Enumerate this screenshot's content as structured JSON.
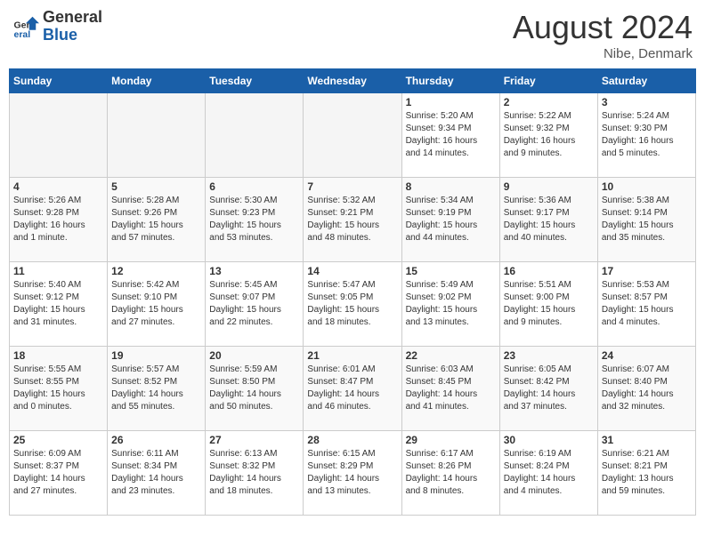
{
  "header": {
    "logo_general": "General",
    "logo_blue": "Blue",
    "month_year": "August 2024",
    "location": "Nibe, Denmark"
  },
  "days_of_week": [
    "Sunday",
    "Monday",
    "Tuesday",
    "Wednesday",
    "Thursday",
    "Friday",
    "Saturday"
  ],
  "weeks": [
    {
      "days": [
        {
          "date": "",
          "info": "",
          "empty": true
        },
        {
          "date": "",
          "info": "",
          "empty": true
        },
        {
          "date": "",
          "info": "",
          "empty": true
        },
        {
          "date": "",
          "info": "",
          "empty": true
        },
        {
          "date": "1",
          "info": "Sunrise: 5:20 AM\nSunset: 9:34 PM\nDaylight: 16 hours\nand 14 minutes.",
          "empty": false
        },
        {
          "date": "2",
          "info": "Sunrise: 5:22 AM\nSunset: 9:32 PM\nDaylight: 16 hours\nand 9 minutes.",
          "empty": false
        },
        {
          "date": "3",
          "info": "Sunrise: 5:24 AM\nSunset: 9:30 PM\nDaylight: 16 hours\nand 5 minutes.",
          "empty": false
        }
      ]
    },
    {
      "days": [
        {
          "date": "4",
          "info": "Sunrise: 5:26 AM\nSunset: 9:28 PM\nDaylight: 16 hours\nand 1 minute.",
          "empty": false
        },
        {
          "date": "5",
          "info": "Sunrise: 5:28 AM\nSunset: 9:26 PM\nDaylight: 15 hours\nand 57 minutes.",
          "empty": false
        },
        {
          "date": "6",
          "info": "Sunrise: 5:30 AM\nSunset: 9:23 PM\nDaylight: 15 hours\nand 53 minutes.",
          "empty": false
        },
        {
          "date": "7",
          "info": "Sunrise: 5:32 AM\nSunset: 9:21 PM\nDaylight: 15 hours\nand 48 minutes.",
          "empty": false
        },
        {
          "date": "8",
          "info": "Sunrise: 5:34 AM\nSunset: 9:19 PM\nDaylight: 15 hours\nand 44 minutes.",
          "empty": false
        },
        {
          "date": "9",
          "info": "Sunrise: 5:36 AM\nSunset: 9:17 PM\nDaylight: 15 hours\nand 40 minutes.",
          "empty": false
        },
        {
          "date": "10",
          "info": "Sunrise: 5:38 AM\nSunset: 9:14 PM\nDaylight: 15 hours\nand 35 minutes.",
          "empty": false
        }
      ]
    },
    {
      "days": [
        {
          "date": "11",
          "info": "Sunrise: 5:40 AM\nSunset: 9:12 PM\nDaylight: 15 hours\nand 31 minutes.",
          "empty": false
        },
        {
          "date": "12",
          "info": "Sunrise: 5:42 AM\nSunset: 9:10 PM\nDaylight: 15 hours\nand 27 minutes.",
          "empty": false
        },
        {
          "date": "13",
          "info": "Sunrise: 5:45 AM\nSunset: 9:07 PM\nDaylight: 15 hours\nand 22 minutes.",
          "empty": false
        },
        {
          "date": "14",
          "info": "Sunrise: 5:47 AM\nSunset: 9:05 PM\nDaylight: 15 hours\nand 18 minutes.",
          "empty": false
        },
        {
          "date": "15",
          "info": "Sunrise: 5:49 AM\nSunset: 9:02 PM\nDaylight: 15 hours\nand 13 minutes.",
          "empty": false
        },
        {
          "date": "16",
          "info": "Sunrise: 5:51 AM\nSunset: 9:00 PM\nDaylight: 15 hours\nand 9 minutes.",
          "empty": false
        },
        {
          "date": "17",
          "info": "Sunrise: 5:53 AM\nSunset: 8:57 PM\nDaylight: 15 hours\nand 4 minutes.",
          "empty": false
        }
      ]
    },
    {
      "days": [
        {
          "date": "18",
          "info": "Sunrise: 5:55 AM\nSunset: 8:55 PM\nDaylight: 15 hours\nand 0 minutes.",
          "empty": false
        },
        {
          "date": "19",
          "info": "Sunrise: 5:57 AM\nSunset: 8:52 PM\nDaylight: 14 hours\nand 55 minutes.",
          "empty": false
        },
        {
          "date": "20",
          "info": "Sunrise: 5:59 AM\nSunset: 8:50 PM\nDaylight: 14 hours\nand 50 minutes.",
          "empty": false
        },
        {
          "date": "21",
          "info": "Sunrise: 6:01 AM\nSunset: 8:47 PM\nDaylight: 14 hours\nand 46 minutes.",
          "empty": false
        },
        {
          "date": "22",
          "info": "Sunrise: 6:03 AM\nSunset: 8:45 PM\nDaylight: 14 hours\nand 41 minutes.",
          "empty": false
        },
        {
          "date": "23",
          "info": "Sunrise: 6:05 AM\nSunset: 8:42 PM\nDaylight: 14 hours\nand 37 minutes.",
          "empty": false
        },
        {
          "date": "24",
          "info": "Sunrise: 6:07 AM\nSunset: 8:40 PM\nDaylight: 14 hours\nand 32 minutes.",
          "empty": false
        }
      ]
    },
    {
      "days": [
        {
          "date": "25",
          "info": "Sunrise: 6:09 AM\nSunset: 8:37 PM\nDaylight: 14 hours\nand 27 minutes.",
          "empty": false
        },
        {
          "date": "26",
          "info": "Sunrise: 6:11 AM\nSunset: 8:34 PM\nDaylight: 14 hours\nand 23 minutes.",
          "empty": false
        },
        {
          "date": "27",
          "info": "Sunrise: 6:13 AM\nSunset: 8:32 PM\nDaylight: 14 hours\nand 18 minutes.",
          "empty": false
        },
        {
          "date": "28",
          "info": "Sunrise: 6:15 AM\nSunset: 8:29 PM\nDaylight: 14 hours\nand 13 minutes.",
          "empty": false
        },
        {
          "date": "29",
          "info": "Sunrise: 6:17 AM\nSunset: 8:26 PM\nDaylight: 14 hours\nand 8 minutes.",
          "empty": false
        },
        {
          "date": "30",
          "info": "Sunrise: 6:19 AM\nSunset: 8:24 PM\nDaylight: 14 hours\nand 4 minutes.",
          "empty": false
        },
        {
          "date": "31",
          "info": "Sunrise: 6:21 AM\nSunset: 8:21 PM\nDaylight: 13 hours\nand 59 minutes.",
          "empty": false
        }
      ]
    }
  ]
}
